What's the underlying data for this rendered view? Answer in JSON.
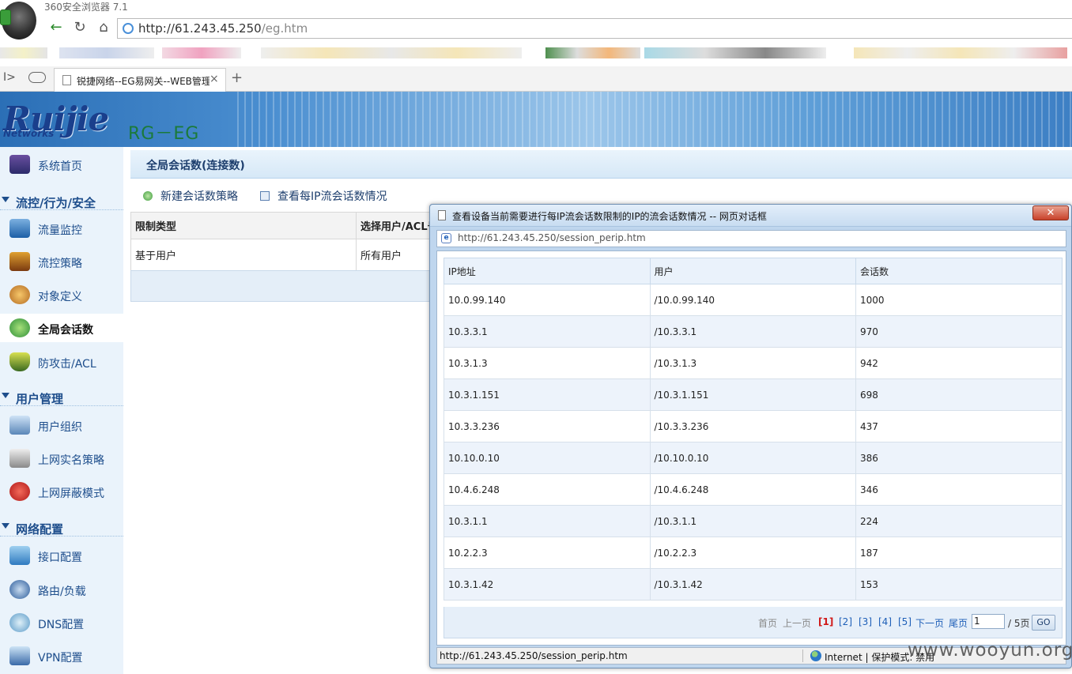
{
  "browser": {
    "name": "360安全浏览器 7.1",
    "url_host": "http://61.243.45.250",
    "url_path": "/eg.htm",
    "tab_title": "锐捷网络--EG易网关--WEB管理",
    "tab_close": "×",
    "new_tab": "+"
  },
  "header": {
    "logo": "Ruijie",
    "logo_sub": "Networks",
    "model": "RG－EG"
  },
  "sidebar": {
    "top_item": "系统首页",
    "groups": [
      {
        "label": "流控/行为/安全",
        "items": [
          "流量监控",
          "流控策略",
          "对象定义",
          "全局会话数",
          "防攻击/ACL"
        ]
      },
      {
        "label": "用户管理",
        "items": [
          "用户组织",
          "上网实名策略",
          "上网屏蔽模式"
        ]
      },
      {
        "label": "网络配置",
        "items": [
          "接口配置",
          "路由/负载",
          "DNS配置",
          "VPN配置"
        ]
      }
    ],
    "active": "全局会话数"
  },
  "main": {
    "title": "全局会话数(连接数)",
    "toolbar": {
      "new_policy": "新建会话数策略",
      "view_per_ip": "查看每IP流会话数情况"
    },
    "table": {
      "headers": [
        "限制类型",
        "选择用户/ACL号"
      ],
      "rows": [
        [
          "基于用户",
          "所有用户"
        ]
      ]
    }
  },
  "dialog": {
    "title": "查看设备当前需要进行每IP流会话数限制的IP的流会话数情况 -- 网页对话框",
    "close": "✕",
    "address": "http://61.243.45.250/session_perip.htm",
    "columns": [
      "IP地址",
      "用户",
      "会话数"
    ],
    "rows": [
      [
        "10.0.99.140",
        "/10.0.99.140",
        "1000"
      ],
      [
        "10.3.3.1",
        "/10.3.3.1",
        "970"
      ],
      [
        "10.3.1.3",
        "/10.3.1.3",
        "942"
      ],
      [
        "10.3.1.151",
        "/10.3.1.151",
        "698"
      ],
      [
        "10.3.3.236",
        "/10.3.3.236",
        "437"
      ],
      [
        "10.10.0.10",
        "/10.10.0.10",
        "386"
      ],
      [
        "10.4.6.248",
        "/10.4.6.248",
        "346"
      ],
      [
        "10.3.1.1",
        "/10.3.1.1",
        "224"
      ],
      [
        "10.2.2.3",
        "/10.2.2.3",
        "187"
      ],
      [
        "10.3.1.42",
        "/10.3.1.42",
        "153"
      ]
    ],
    "pager": {
      "first": "首页",
      "prev": "上一页",
      "pages": [
        "[1]",
        "[2]",
        "[3]",
        "[4]",
        "[5]"
      ],
      "next": "下一页",
      "last": "尾页",
      "page_input": "1",
      "total": "/ 5页",
      "go": "GO"
    },
    "status": {
      "url": "http://61.243.45.250/session_perip.htm",
      "zone": "Internet | 保护模式: 禁用"
    }
  },
  "watermark": "www.wooyun.org"
}
